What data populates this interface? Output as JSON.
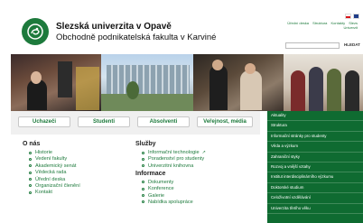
{
  "header": {
    "title": "Slezská univerzita v Opavě",
    "subtitle": "Obchodně podnikatelská fakulta v Karviné",
    "top_links": [
      "Úřední deska",
      "Struktura",
      "Kontakty",
      "Slezs"
    ],
    "top_links_line2": "Univerzit",
    "langs": [
      "cz",
      "en"
    ],
    "search": {
      "value": "",
      "placeholder": ""
    },
    "search_button": "HLEDAT"
  },
  "tabs": [
    "Uchazeči",
    "Studenti",
    "Absolventi",
    "Veřejnost, média"
  ],
  "col_left": {
    "heading": "O nás",
    "items": [
      "Historie",
      "Vedení fakulty",
      "Akademický senát",
      "Vědecká rada",
      "Úřední deska",
      "Organizační členění",
      "Kontakt"
    ]
  },
  "col_right": {
    "heading": "Služby",
    "items": [
      "Informační technologie",
      "Poradenství pro studenty",
      "Univerzitní knihovna"
    ],
    "heading2": "Informace",
    "items2": [
      "Dokumenty",
      "Konference",
      "Galerie",
      "Nabídka spolupráce"
    ]
  },
  "green_menu": [
    "Aktuality",
    "Struktura",
    "Informační stránky pro studenty",
    "Věda a výzkum",
    "Zahraniční styky",
    "Rozvoj a vnější vztahy",
    "Institut interdisciplinárního výzkumu",
    "Doktorské studium",
    "Celoživotní vzdělávání",
    "Univerzita třetího věku"
  ],
  "colors": {
    "accent": "#1d7a3c",
    "menu_bg": "#0f6b31"
  }
}
